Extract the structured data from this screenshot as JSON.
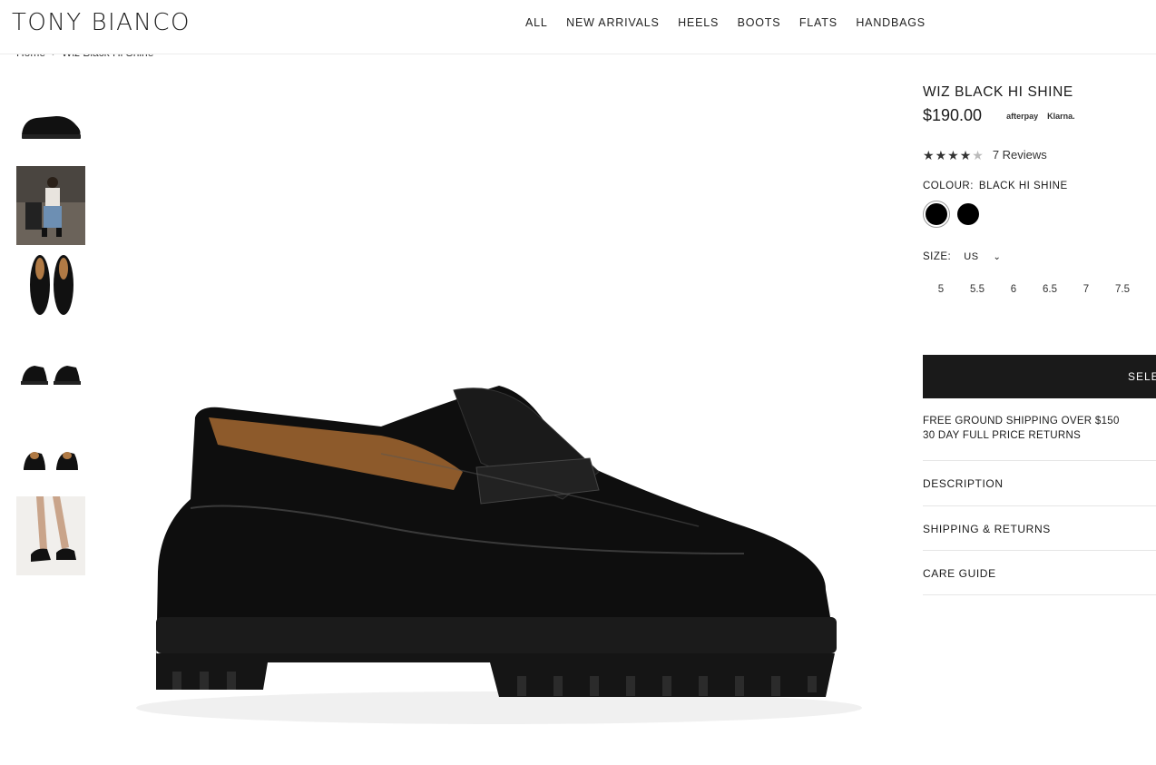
{
  "brand": {
    "logo_text": "TONY BIANCO"
  },
  "nav": {
    "items": [
      "ALL",
      "NEW ARRIVALS",
      "HEELS",
      "BOOTS",
      "FLATS",
      "HANDBAGS"
    ]
  },
  "breadcrumb": {
    "home": "Home",
    "current": "Wiz Black Hi Shine"
  },
  "product": {
    "title": "WIZ BLACK HI SHINE",
    "price": "$190.00",
    "payment_1": "afterpay",
    "payment_2": "Klarna.",
    "rating": 4.5,
    "reviews_label": "7 Reviews",
    "colour_label": "COLOUR:",
    "colour_value": "BLACK HI SHINE",
    "swatch_colors": [
      "#000000",
      "#000000"
    ],
    "size_label": "SIZE:",
    "size_system": "US",
    "sizes": [
      "5",
      "5.5",
      "6",
      "6.5",
      "7",
      "7.5"
    ],
    "cta_label": "SELEC",
    "shipping_line_1": "FREE GROUND SHIPPING OVER $150",
    "shipping_line_2": "30 DAY FULL PRICE RETURNS",
    "accordions": [
      "DESCRIPTION",
      "SHIPPING & RETURNS",
      "CARE GUIDE"
    ]
  },
  "thumbnails": [
    "loafer-side-thumb",
    "lifestyle-seated-thumb",
    "pair-top-thumb",
    "pair-front-thumb",
    "pair-back-thumb",
    "on-foot-thumb"
  ]
}
